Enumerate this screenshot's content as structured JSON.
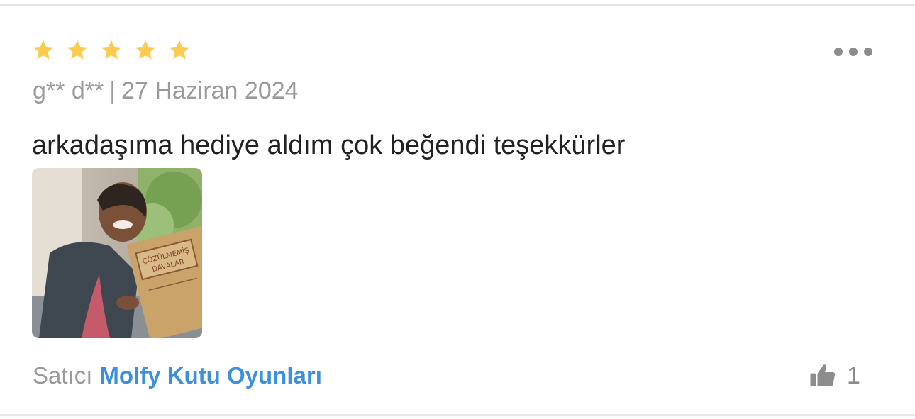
{
  "review": {
    "rating": 5,
    "rating_max": 5,
    "author": "g** d**",
    "separator": "|",
    "date": "27 Haziran 2024",
    "comment": "arkadaşıma hediye aldım çok beğendi teşekkürler",
    "photo": {
      "product_text_line1": "ÇÖZÜLMEMİŞ",
      "product_text_line2": "DAVALAR"
    }
  },
  "seller": {
    "label": "Satıcı",
    "name": "Molfy Kutu Oyunları"
  },
  "likes": {
    "count": "1"
  },
  "colors": {
    "star": "#fccc4f",
    "seller_link": "#3d8fe0",
    "muted_text": "#9a9a9a",
    "body_text": "#222222",
    "icon_gray": "#8c8c8c",
    "divider": "#e6e6e6"
  },
  "icons": {
    "rating": "star-icon",
    "menu": "more-horizontal-icon",
    "like": "thumbs-up-icon"
  }
}
